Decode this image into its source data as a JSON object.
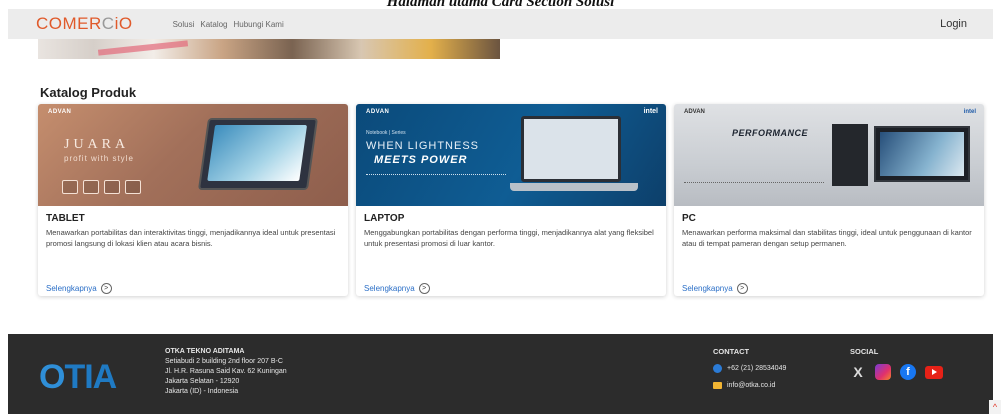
{
  "caption": "Halaman utama Card Section Solusi",
  "navbar": {
    "logo_prefix": "COMER",
    "logo_o": "C",
    "logo_suffix": "iO",
    "links": [
      "Solusi",
      "Katalog",
      "Hubungi Kami"
    ],
    "login": "Login"
  },
  "section_title": "Katalog Produk",
  "cards": [
    {
      "banner_brand": "ADVAN",
      "banner_word": "JUARA",
      "banner_sub": "profit with style",
      "title": "TABLET",
      "description": "Menawarkan portabilitas dan interaktivitas tinggi, menjadikannya ideal untuk presentasi promosi langsung di lokasi klien atau acara bisnis.",
      "link": "Selengkapnya"
    },
    {
      "banner_brand": "ADVAN",
      "banner_intel": "intel",
      "banner_small": "Notebook | Series",
      "banner_word1": "WHEN LIGHTNESS",
      "banner_word2": "MEETS POWER",
      "title": "LAPTOP",
      "description": "Menggabungkan portabilitas dengan performa tinggi, menjadikannya alat yang fleksibel untuk presentasi promosi di luar kantor.",
      "link": "Selengkapnya"
    },
    {
      "banner_brand": "ADVAN",
      "banner_intel": "intel",
      "banner_word": "PERFORMANCE",
      "title": "PC",
      "description": "Menawarkan performa maksimal dan stabilitas tinggi, ideal untuk penggunaan di kantor atau di tempat pameran dengan setup permanen.",
      "link": "Selengkapnya"
    }
  ],
  "footer": {
    "logo_a": "O",
    "logo_b": "TIA",
    "company_name": "OTKA TEKNO ADITAMA",
    "address_lines": [
      "Setiabudi 2 building 2nd floor 207 B-C",
      "Jl. H.R. Rasuna Said Kav. 62 Kuningan",
      "Jakarta Selatan - 12920",
      "Jakarta (ID) - Indonesia"
    ],
    "contact_heading": "CONTACT",
    "phone": "+62 (21) 28534049",
    "email": "info@otka.co.id",
    "social_heading": "SOCIAL",
    "social": {
      "x_glyph": "X",
      "fb_glyph": "f"
    }
  },
  "scroll_top_glyph": "^",
  "arrow_glyph": ">",
  "icons": {
    "phone": "phone-icon",
    "mail": "mail-icon",
    "x": "x-twitter-icon",
    "instagram": "instagram-icon",
    "facebook": "facebook-icon",
    "youtube": "youtube-icon"
  }
}
